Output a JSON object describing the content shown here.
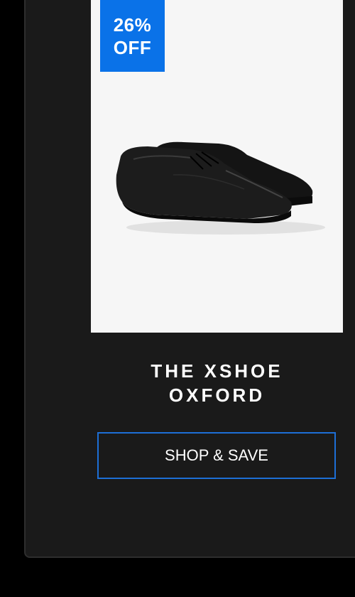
{
  "badge": {
    "percent": "26%",
    "off": "OFF",
    "color": "#0a72e8"
  },
  "product": {
    "title_line1": "THE XSHOE",
    "title_line2": "OXFORD",
    "image_icon": "black-oxford-shoe-image"
  },
  "cta": {
    "label": "SHOP & SAVE",
    "border_color": "#1d6fd6"
  }
}
